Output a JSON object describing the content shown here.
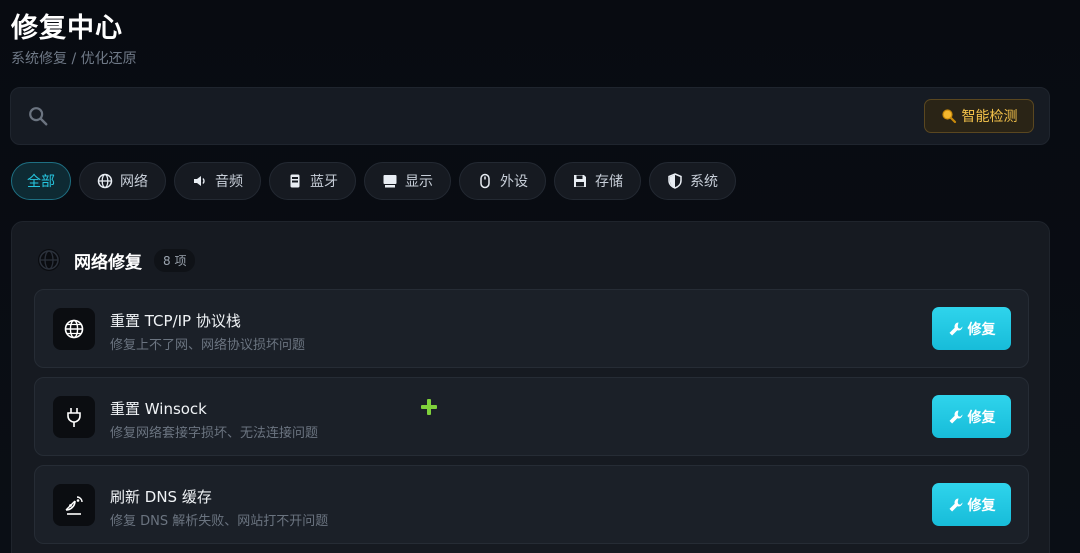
{
  "header": {
    "title": "修复中心",
    "subtitle": "系统修复 / 优化还原"
  },
  "search": {
    "placeholder": "",
    "detect_button_label": "智能检测",
    "detect_icon": "magnifier-emoji-icon"
  },
  "filters": [
    {
      "label": "全部",
      "icon": "",
      "active": true
    },
    {
      "label": "网络",
      "icon": "globe-icon",
      "active": false
    },
    {
      "label": "音频",
      "icon": "speaker-icon",
      "active": false
    },
    {
      "label": "蓝牙",
      "icon": "bluetooth-device-icon",
      "active": false
    },
    {
      "label": "显示",
      "icon": "monitor-icon",
      "active": false
    },
    {
      "label": "外设",
      "icon": "mouse-icon",
      "active": false
    },
    {
      "label": "存储",
      "icon": "floppy-icon",
      "active": false
    },
    {
      "label": "系统",
      "icon": "shield-icon",
      "active": false
    }
  ],
  "section": {
    "title": "网络修复",
    "count": "8 项",
    "icon": "globe-icon",
    "items": [
      {
        "title": "重置 TCP/IP 协议栈",
        "desc": "修复上不了网、网络协议损坏问题",
        "icon": "globe-icon",
        "button": "修复"
      },
      {
        "title": "重置 Winsock",
        "desc": "修复网络套接字损坏、无法连接问题",
        "icon": "plug-icon",
        "button": "修复"
      },
      {
        "title": "刷新 DNS 缓存",
        "desc": "修复 DNS 解析失败、网站打不开问题",
        "icon": "satellite-icon",
        "button": "修复"
      }
    ]
  },
  "colors": {
    "accent": "#1ec8e2",
    "detect": "#f2c14a",
    "background": "#080b11",
    "cursor": "#7fd13b"
  }
}
